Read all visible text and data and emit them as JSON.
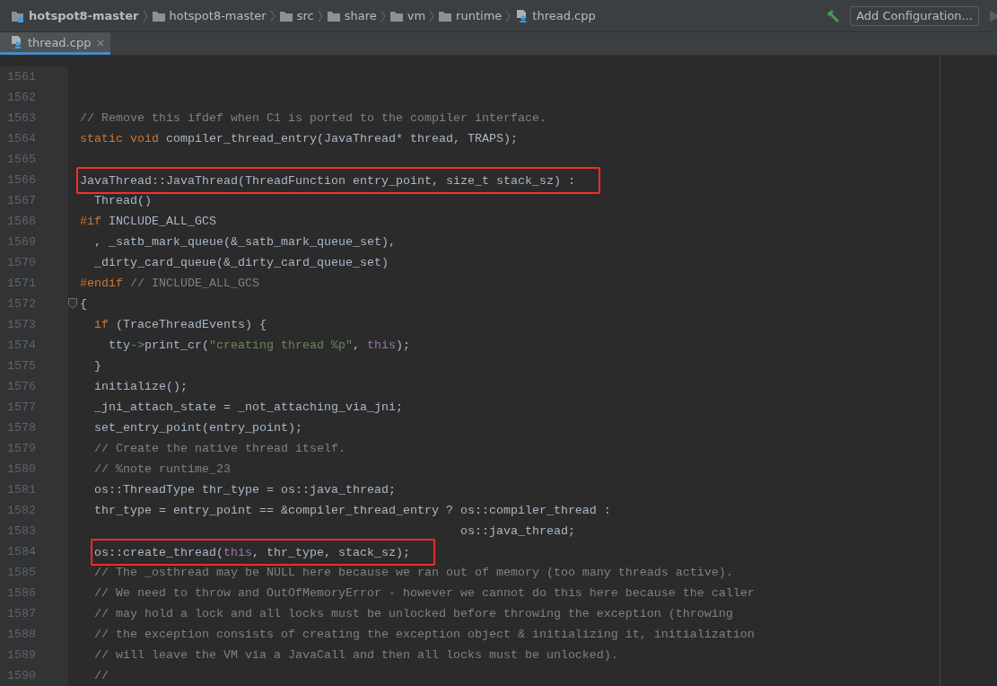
{
  "navbar": {
    "breadcrumbs": [
      {
        "label": "hotspot8-master",
        "kind": "module"
      },
      {
        "label": "hotspot8-master",
        "kind": "folder"
      },
      {
        "label": "src",
        "kind": "folder"
      },
      {
        "label": "share",
        "kind": "folder"
      },
      {
        "label": "vm",
        "kind": "folder"
      },
      {
        "label": "runtime",
        "kind": "folder"
      },
      {
        "label": "thread.cpp",
        "kind": "file"
      }
    ],
    "run_configuration": {
      "label": "Add Configuration..."
    }
  },
  "tabs": [
    {
      "label": "thread.cpp",
      "selected": true,
      "close": "×"
    }
  ],
  "editor": {
    "lines": [
      {
        "number": "1561",
        "fold_marker": false,
        "highlighted": false
      },
      {
        "number": "1562",
        "fold_marker": false,
        "highlighted": false
      },
      {
        "number": "1563",
        "fold_marker": false,
        "highlighted": false,
        "segments": [
          {
            "kind": "comment",
            "text": "// Remove this ifdef when C1 is ported to the compiler interface."
          }
        ]
      },
      {
        "number": "1564",
        "fold_marker": false,
        "highlighted": false,
        "segments": [
          {
            "kind": "keyword",
            "text": "static void"
          },
          {
            "kind": "plain",
            "text": " compiler_thread_entry(JavaThread* thread, TRAPS);"
          }
        ]
      },
      {
        "number": "1565",
        "fold_marker": false,
        "highlighted": false
      },
      {
        "number": "1566",
        "fold_marker": false,
        "highlighted": true,
        "segments": [
          {
            "kind": "plain",
            "text": "JavaThread::JavaThread(ThreadFunction entry_point, size_t stack_sz) :"
          }
        ]
      },
      {
        "number": "1567",
        "fold_marker": false,
        "highlighted": false,
        "segments": [
          {
            "kind": "plain",
            "text": "  Thread()"
          }
        ]
      },
      {
        "number": "1568",
        "fold_marker": false,
        "highlighted": false,
        "segments": [
          {
            "kind": "keyword",
            "text": "#if"
          },
          {
            "kind": "plain",
            "text": " INCLUDE_ALL_GCS"
          }
        ]
      },
      {
        "number": "1569",
        "fold_marker": false,
        "highlighted": false,
        "segments": [
          {
            "kind": "plain",
            "text": "  , _satb_mark_queue(&_satb_mark_queue_set),"
          }
        ]
      },
      {
        "number": "1570",
        "fold_marker": false,
        "highlighted": false,
        "segments": [
          {
            "kind": "plain",
            "text": "  _dirty_card_queue(&_dirty_card_queue_set)"
          }
        ]
      },
      {
        "number": "1571",
        "fold_marker": false,
        "highlighted": false,
        "segments": [
          {
            "kind": "keyword",
            "text": "#endif"
          },
          {
            "kind": "comment",
            "text": " // INCLUDE_ALL_GCS"
          }
        ]
      },
      {
        "number": "1572",
        "fold_marker": true,
        "highlighted": false,
        "segments": [
          {
            "kind": "plain",
            "text": "{"
          }
        ]
      },
      {
        "number": "1573",
        "fold_marker": false,
        "highlighted": false,
        "segments": [
          {
            "kind": "keyword",
            "text": "  if"
          },
          {
            "kind": "plain",
            "text": " (TraceThreadEvents) {"
          }
        ]
      },
      {
        "number": "1574",
        "fold_marker": false,
        "highlighted": false,
        "segments": [
          {
            "kind": "plain",
            "text": "    tty"
          },
          {
            "kind": "operator",
            "text": "->"
          },
          {
            "kind": "plain",
            "text": "print_cr("
          },
          {
            "kind": "string",
            "text": "\"creating thread %p\""
          },
          {
            "kind": "plain",
            "text": ", "
          },
          {
            "kind": "self",
            "text": "this"
          },
          {
            "kind": "plain",
            "text": ");"
          }
        ]
      },
      {
        "number": "1575",
        "fold_marker": false,
        "highlighted": false,
        "segments": [
          {
            "kind": "plain",
            "text": "  }"
          }
        ]
      },
      {
        "number": "1576",
        "fold_marker": false,
        "highlighted": false,
        "segments": [
          {
            "kind": "plain",
            "text": "  initialize();"
          }
        ]
      },
      {
        "number": "1577",
        "fold_marker": false,
        "highlighted": false,
        "segments": [
          {
            "kind": "plain",
            "text": "  _jni_attach_state = _not_attaching_via_jni;"
          }
        ]
      },
      {
        "number": "1578",
        "fold_marker": false,
        "highlighted": false,
        "segments": [
          {
            "kind": "plain",
            "text": "  set_entry_point(entry_point);"
          }
        ]
      },
      {
        "number": "1579",
        "fold_marker": false,
        "highlighted": false,
        "segments": [
          {
            "kind": "comment",
            "text": "  // Create the native thread itself."
          }
        ]
      },
      {
        "number": "1580",
        "fold_marker": false,
        "highlighted": false,
        "segments": [
          {
            "kind": "comment",
            "text": "  // %note runtime_23"
          }
        ]
      },
      {
        "number": "1581",
        "fold_marker": false,
        "highlighted": false,
        "segments": [
          {
            "kind": "plain",
            "text": "  os::ThreadType thr_type = os::java_thread;"
          }
        ]
      },
      {
        "number": "1582",
        "fold_marker": false,
        "highlighted": false,
        "segments": [
          {
            "kind": "plain",
            "text": "  thr_type = entry_point == &compiler_thread_entry ? os::compiler_thread :"
          }
        ]
      },
      {
        "number": "1583",
        "fold_marker": false,
        "highlighted": false,
        "segments": [
          {
            "kind": "plain",
            "text": "                                                     os::java_thread;"
          }
        ]
      },
      {
        "number": "1584",
        "fold_marker": false,
        "highlighted": true,
        "segments": [
          {
            "kind": "plain",
            "text": "  os::create_thread("
          },
          {
            "kind": "self",
            "text": "this"
          },
          {
            "kind": "plain",
            "text": ", thr_type, stack_sz);"
          }
        ]
      },
      {
        "number": "1585",
        "fold_marker": false,
        "highlighted": false,
        "segments": [
          {
            "kind": "comment",
            "text": "  // The _osthread may be NULL here because we ran out of memory (too many threads active)."
          }
        ]
      },
      {
        "number": "1586",
        "fold_marker": false,
        "highlighted": false,
        "segments": [
          {
            "kind": "comment",
            "text": "  // We need to throw and OutOfMemoryError - however we cannot do this here because the caller"
          }
        ]
      },
      {
        "number": "1587",
        "fold_marker": false,
        "highlighted": false,
        "segments": [
          {
            "kind": "comment",
            "text": "  // may hold a lock and all locks must be unlocked before throwing the exception (throwing"
          }
        ]
      },
      {
        "number": "1588",
        "fold_marker": false,
        "highlighted": false,
        "segments": [
          {
            "kind": "comment",
            "text": "  // the exception consists of creating the exception object & initializing it, initialization"
          }
        ]
      },
      {
        "number": "1589",
        "fold_marker": false,
        "highlighted": false,
        "segments": [
          {
            "kind": "comment",
            "text": "  // will leave the VM via a JavaCall and then all locks must be unlocked)."
          }
        ]
      },
      {
        "number": "1590",
        "fold_marker": false,
        "highlighted": false,
        "segments": [
          {
            "kind": "comment",
            "text": "  //"
          }
        ]
      }
    ]
  }
}
